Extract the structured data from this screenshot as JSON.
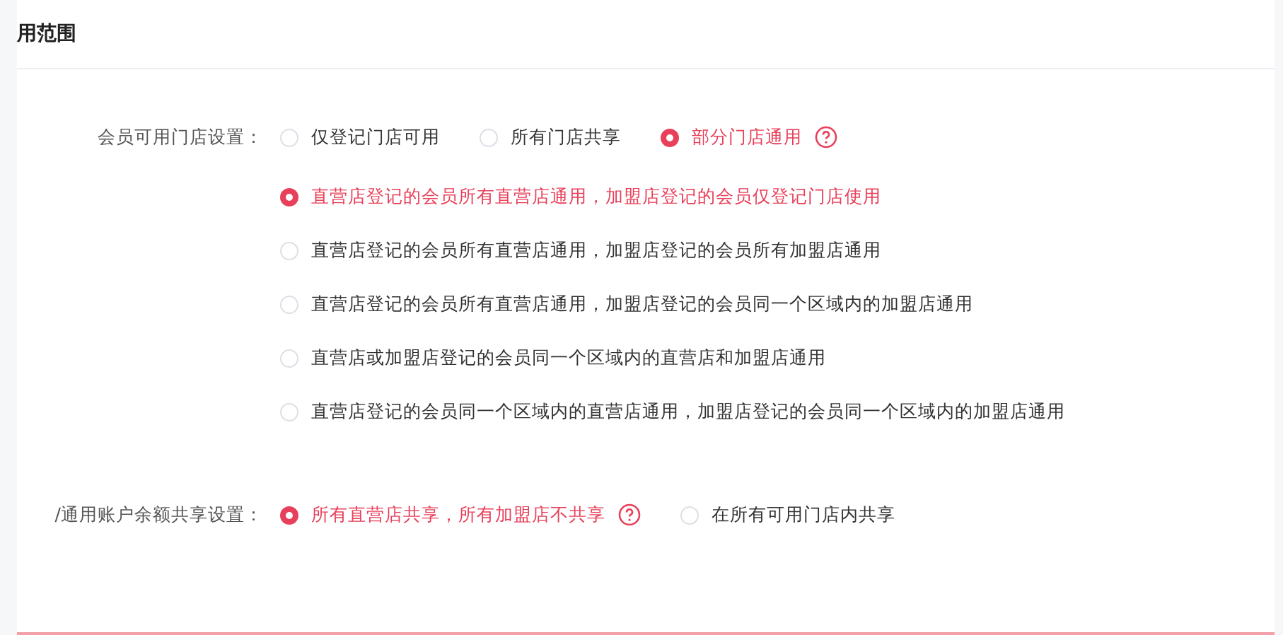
{
  "section": {
    "title": "用范围"
  },
  "settings": [
    {
      "label": "会员可用门店设置：",
      "options": [
        {
          "label": "仅登记门店可用",
          "selected": false,
          "help": false
        },
        {
          "label": "所有门店共享",
          "selected": false,
          "help": false
        },
        {
          "label": "部分门店通用",
          "selected": true,
          "help": true
        }
      ],
      "sub_options": [
        {
          "label": "直营店登记的会员所有直营店通用，加盟店登记的会员仅登记门店使用",
          "selected": true
        },
        {
          "label": "直营店登记的会员所有直营店通用，加盟店登记的会员所有加盟店通用",
          "selected": false
        },
        {
          "label": "直营店登记的会员所有直营店通用，加盟店登记的会员同一个区域内的加盟店通用",
          "selected": false
        },
        {
          "label": "直营店或加盟店登记的会员同一个区域内的直营店和加盟店通用",
          "selected": false
        },
        {
          "label": "直营店登记的会员同一个区域内的直营店通用，加盟店登记的会员同一个区域内的加盟店通用",
          "selected": false
        }
      ]
    },
    {
      "label": "/通用账户余额共享设置：",
      "options": [
        {
          "label": "所有直营店共享，所有加盟店不共享",
          "selected": true,
          "help": true
        },
        {
          "label": "在所有可用门店内共享",
          "selected": false,
          "help": false
        }
      ]
    }
  ]
}
